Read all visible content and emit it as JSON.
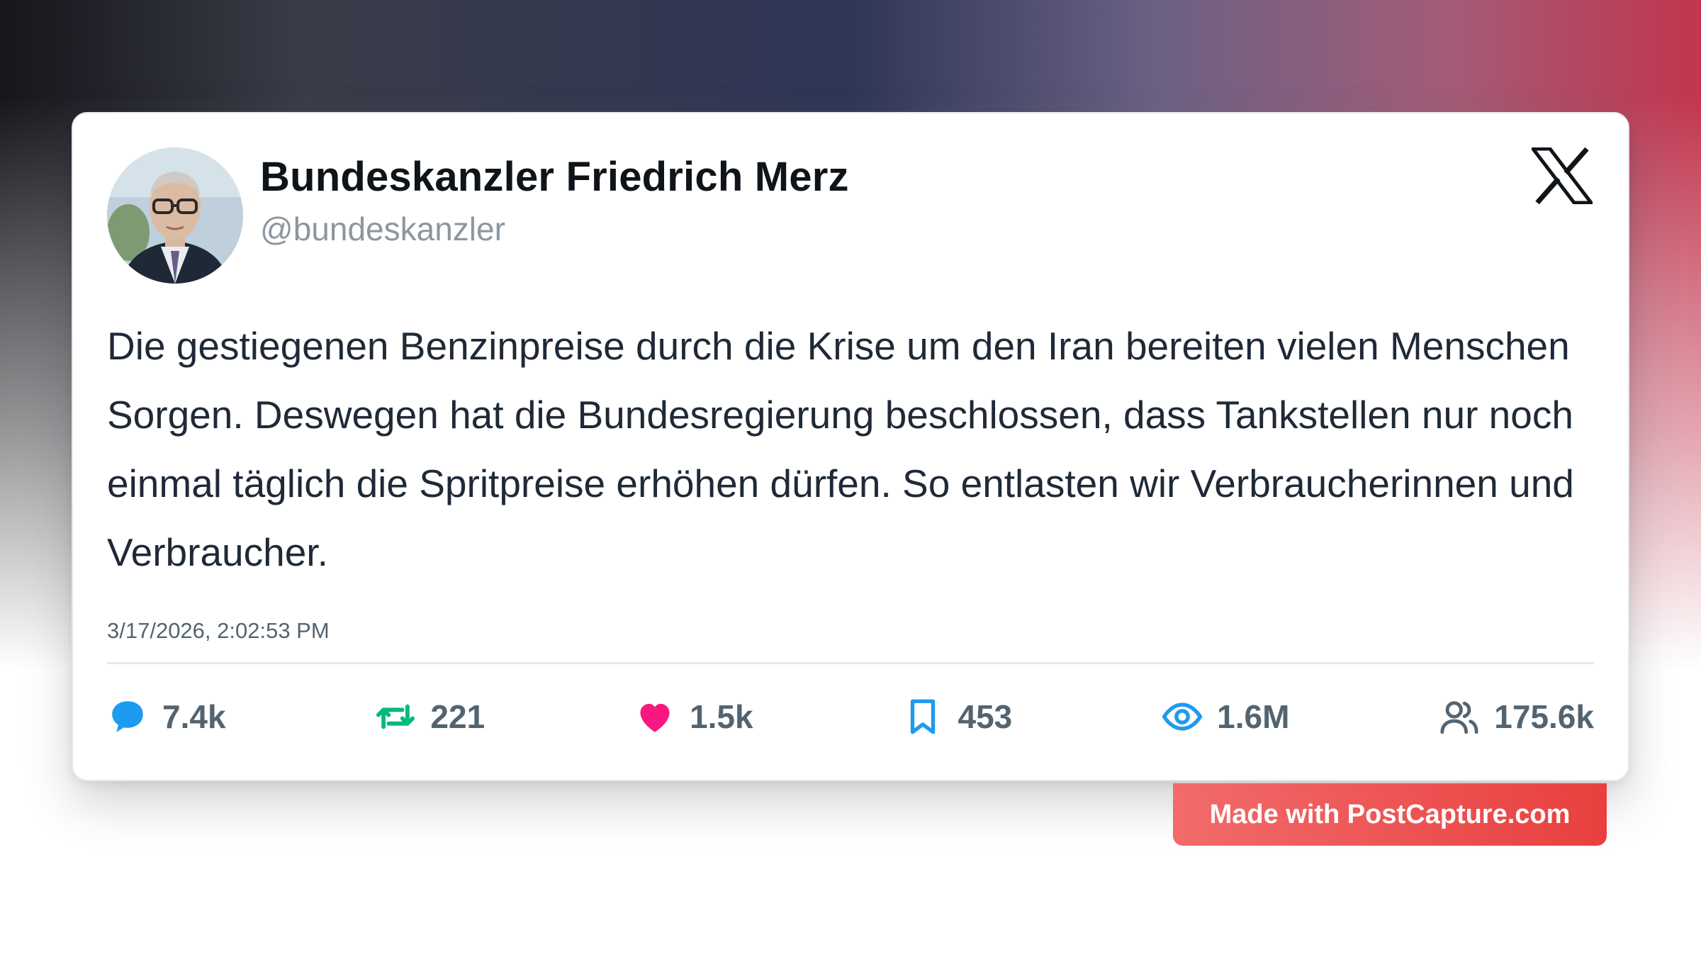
{
  "author": {
    "name": "Bundeskanzler Friedrich Merz",
    "handle": "@bundeskanzler"
  },
  "platform_icon": "x-logo-icon",
  "tweet": {
    "text": "Die gestiegenen Benzinpreise durch die Krise um den Iran bereiten vielen Menschen Sorgen. Deswegen hat die Bundesregierung beschlossen, dass Tankstellen nur noch einmal täglich die Spritpreise erhöhen dürfen. So entlasten wir Verbraucherinnen und Verbraucher.",
    "timestamp": "3/17/2026, 2:02:53 PM"
  },
  "stats": {
    "replies": {
      "icon": "comment-icon",
      "value": "7.4k",
      "color": "#1d9bf0"
    },
    "retweets": {
      "icon": "retweet-icon",
      "value": "221",
      "color": "#00ba7c"
    },
    "likes": {
      "icon": "heart-icon",
      "value": "1.5k",
      "color": "#f91880"
    },
    "bookmarks": {
      "icon": "bookmark-icon",
      "value": "453",
      "color": "#1d9bf0"
    },
    "views": {
      "icon": "eye-icon",
      "value": "1.6M",
      "color": "#1d9bf0"
    },
    "followers": {
      "icon": "users-icon",
      "value": "175.6k",
      "color": "#536471"
    }
  },
  "watermark": {
    "label": "Made with PostCapture.com",
    "color": "#e8403f"
  }
}
